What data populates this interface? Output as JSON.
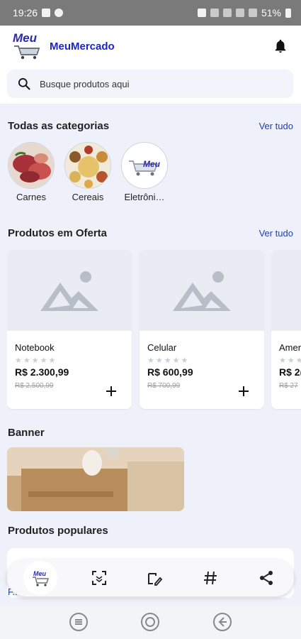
{
  "status": {
    "time": "19:26",
    "battery": "51%"
  },
  "header": {
    "logo_text": "Meu",
    "title": "MeuMercado"
  },
  "search": {
    "placeholder": "Busque produtos aqui"
  },
  "categories_section": {
    "title": "Todas as categorias",
    "see_all": "Ver tudo",
    "items": [
      {
        "label": "Carnes"
      },
      {
        "label": "Cereais"
      },
      {
        "label": "Eletrôni…"
      }
    ]
  },
  "offers_section": {
    "title": "Produtos em Oferta",
    "see_all": "Ver tudo",
    "products": [
      {
        "name": "Notebook",
        "stars": "★★★★★",
        "price": "R$ 2.300,99",
        "old_price": "R$ 2.500,99"
      },
      {
        "name": "Celular",
        "stars": "★★★★★",
        "price": "R$ 600,99",
        "old_price": "R$ 700,99"
      },
      {
        "name": "Amer",
        "stars": "★★★",
        "price": "R$ 2(",
        "old_price": "R$ 27"
      }
    ]
  },
  "banner_section": {
    "title": "Banner"
  },
  "popular_section": {
    "title": "Produtos populares",
    "peek_text": "F..."
  },
  "toolbar": {
    "icons": [
      "app-icon",
      "scan-icon",
      "edit-icon",
      "hashtag-icon",
      "share-icon"
    ]
  },
  "colors": {
    "accent": "#1a24c8",
    "background": "#eef1f9"
  }
}
